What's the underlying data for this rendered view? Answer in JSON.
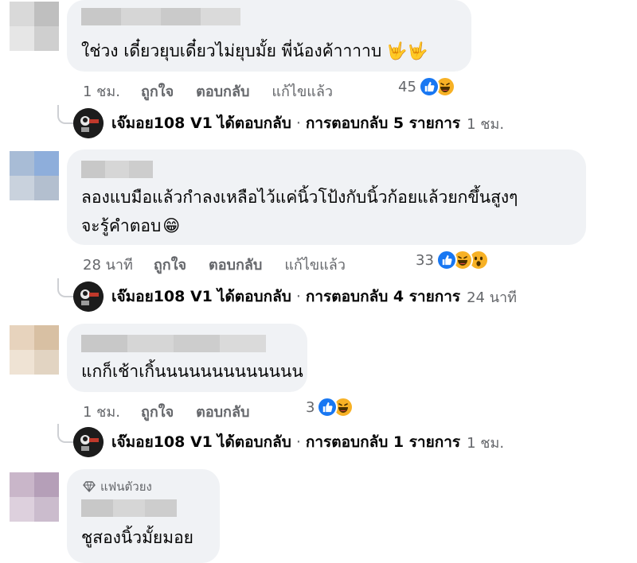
{
  "comments": [
    {
      "text_lines": [
        "ใช่วง เดี๋ยวยุบเดี๋ยวไม่ยุบมั้ย พี่น้องค้าาาาบ"
      ],
      "time": "1 ชม.",
      "like_label": "ถูกใจ",
      "reply_label": "ตอบกลับ",
      "edited_label": "แก้ไขแล้ว",
      "reaction_count": "45",
      "reactions": [
        "like-icon",
        "haha-icon"
      ],
      "emoji_suffix": "🤟🤟",
      "reply_summary": {
        "name": "เจ๊มอย108 V1",
        "action": "ได้ตอบกลับ",
        "separator": "·",
        "count": "การตอบกลับ 5 รายการ",
        "time": "1 ชม."
      }
    },
    {
      "text_lines": [
        "ลองแบมือแล้วกำลงเหลือไว้แค่นิ้วโป้งกับนิ้วก้อยแล้วยกขึ้นสูงๆ",
        "จะรู้คำตอบ"
      ],
      "time": "28 นาที",
      "like_label": "ถูกใจ",
      "reply_label": "ตอบกลับ",
      "edited_label": "แก้ไขแล้ว",
      "reaction_count": "33",
      "reactions": [
        "like-icon",
        "haha-icon",
        "wow-icon"
      ],
      "emoji_suffix": "😁",
      "reply_summary": {
        "name": "เจ๊มอย108 V1",
        "action": "ได้ตอบกลับ",
        "separator": "·",
        "count": "การตอบกลับ 4 รายการ",
        "time": "24 นาที"
      }
    },
    {
      "text_lines": [
        "แกก็เช้าเกิ้นนนนนนนนนนนนน"
      ],
      "time": "1 ชม.",
      "like_label": "ถูกใจ",
      "reply_label": "ตอบกลับ",
      "reaction_count": "3",
      "reactions": [
        "like-icon",
        "haha-icon"
      ],
      "reply_summary": {
        "name": "เจ๊มอย108 V1",
        "action": "ได้ตอบกลับ",
        "separator": "·",
        "count": "การตอบกลับ 1 รายการ",
        "time": "1 ชม."
      }
    },
    {
      "badge": "แฟนตัวยง",
      "badge_icon": "diamond-icon",
      "text_lines": [
        "ชูสองนิ้วมั้ยมอย"
      ]
    }
  ],
  "colors": {
    "bubble": "#f0f2f5",
    "meta": "#65676b",
    "like": "#1877f2",
    "haha": "#f7b125"
  }
}
